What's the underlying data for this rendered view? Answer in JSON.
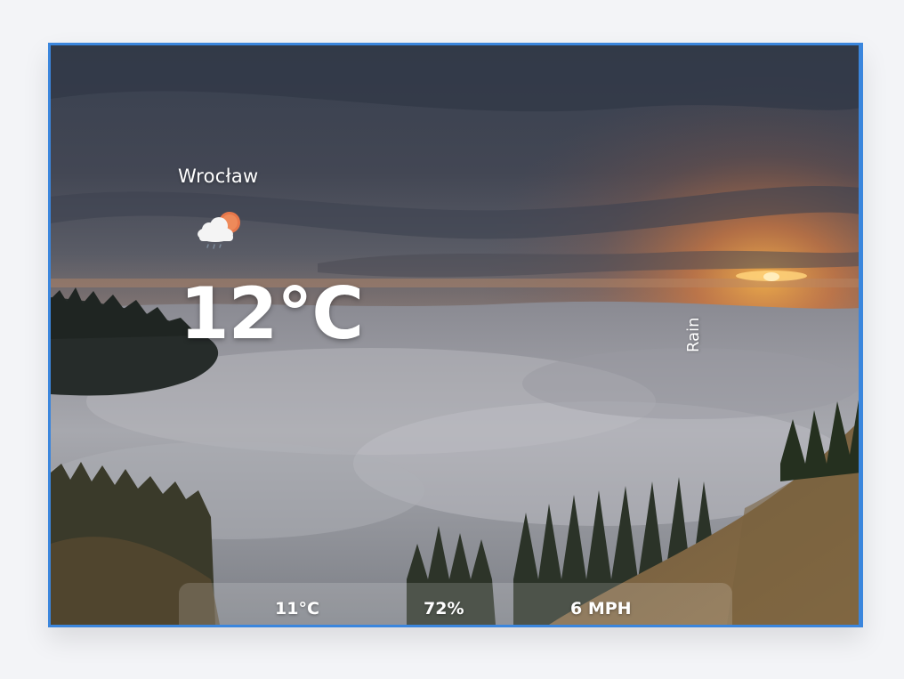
{
  "weather": {
    "city": "Wrocław",
    "temperature": "12°C",
    "condition": "Rain",
    "icon": "rain-cloud-sun-icon"
  },
  "stats": {
    "feels_like": "11°C",
    "humidity": "72%",
    "wind": "6 MPH"
  },
  "colors": {
    "card_border": "#3b86dd",
    "text": "#ffffff",
    "sun": "#e8774a",
    "cloud": "#f4f4f4"
  }
}
